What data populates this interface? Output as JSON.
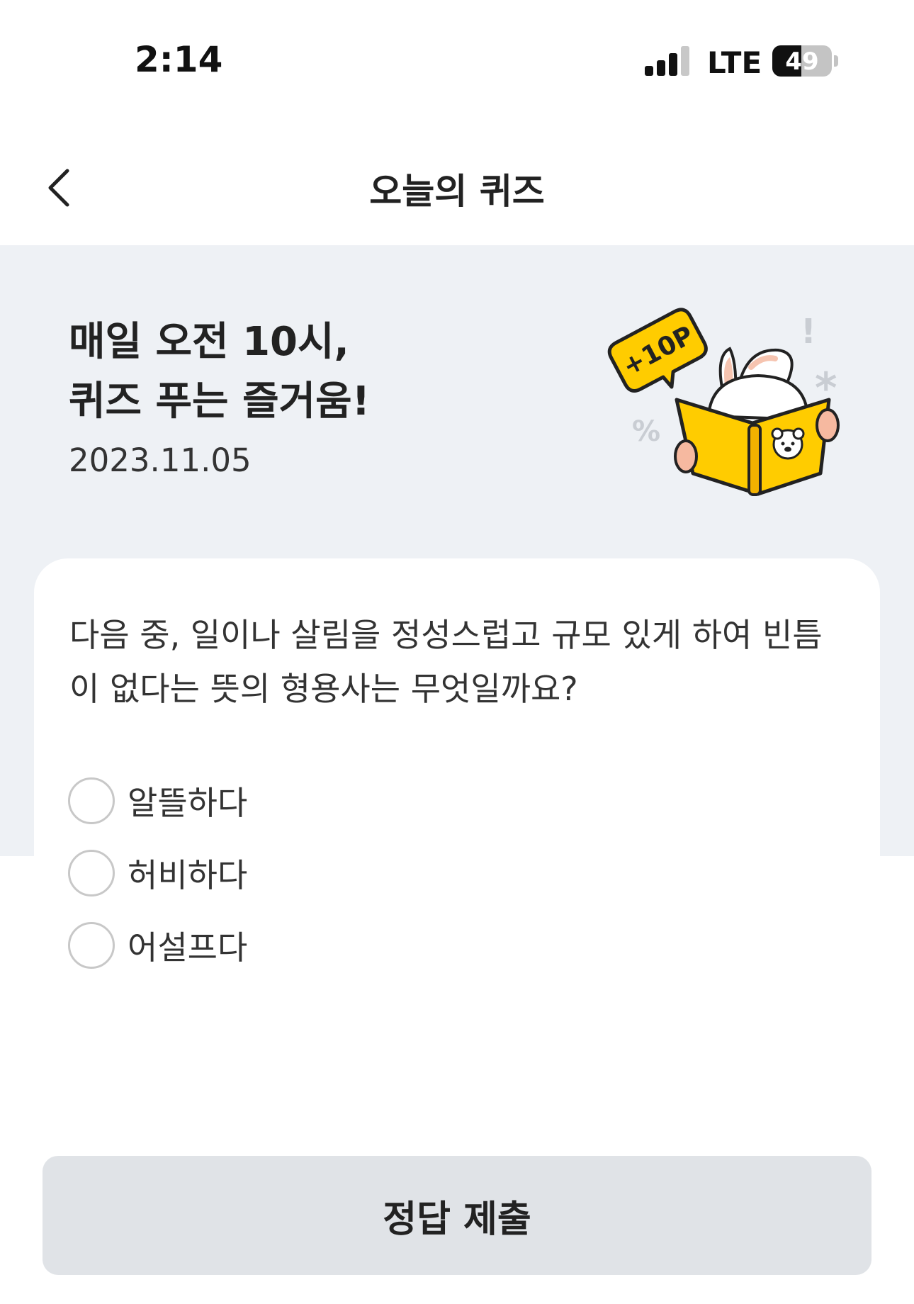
{
  "status_bar": {
    "time": "2:14",
    "network": "LTE",
    "battery": "49",
    "battery_level": 0.49,
    "signal_bars_active": 3
  },
  "nav": {
    "back_icon": "chevron-left-icon",
    "title": "오늘의 퀴즈"
  },
  "hero": {
    "title_line1": "매일 오전 10시,",
    "title_line2": "퀴즈 푸는 즐거움!",
    "date": "2023.11.05",
    "badge": "+10P",
    "colors": {
      "background": "#eef1f5",
      "accent": "#ffcc00"
    }
  },
  "quiz": {
    "question": "다음 중, 일이나 살림을 정성스럽고 규모 있게 하여 빈틈이 없다는 뜻의 형용사는 무엇일까요?",
    "options": [
      {
        "label": "알뜰하다",
        "selected": false
      },
      {
        "label": "허비하다",
        "selected": false
      },
      {
        "label": "어설프다",
        "selected": false
      }
    ]
  },
  "submit": {
    "label": "정답 제출",
    "color": "#e0e3e7"
  }
}
